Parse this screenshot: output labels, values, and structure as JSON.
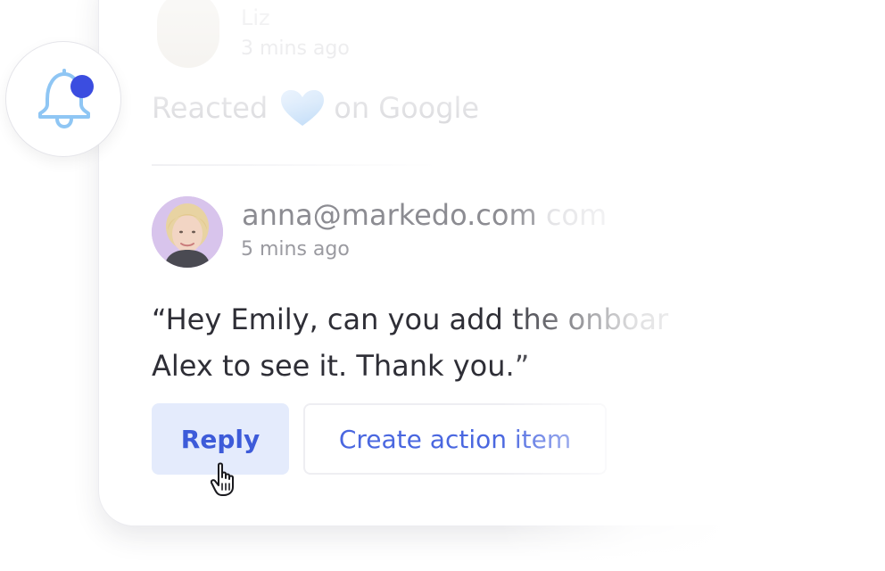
{
  "previous_notification": {
    "name": "Liz",
    "time": "3 mins ago",
    "reaction_prefix": "Reacted",
    "reaction_suffix": "on Google"
  },
  "notification": {
    "sender": "anna@markedo.com",
    "sender_overflow": "com",
    "time": "5 mins ago",
    "message_line1": "“Hey Emily, can you add the onboar",
    "message_line2": "Alex to see it. Thank you.”"
  },
  "actions": {
    "reply_label": "Reply",
    "create_action_label": "Create action item"
  },
  "colors": {
    "accent": "#3d5bd9",
    "reply_bg": "#e4ebfc",
    "bell_stroke": "#8fc6f4",
    "notification_dot": "#3b4de0",
    "avatar_bg": "#d8c4ec"
  },
  "icons": {
    "bell": "bell-icon",
    "heart": "heart-icon",
    "cursor": "hand-pointer-cursor-icon"
  }
}
